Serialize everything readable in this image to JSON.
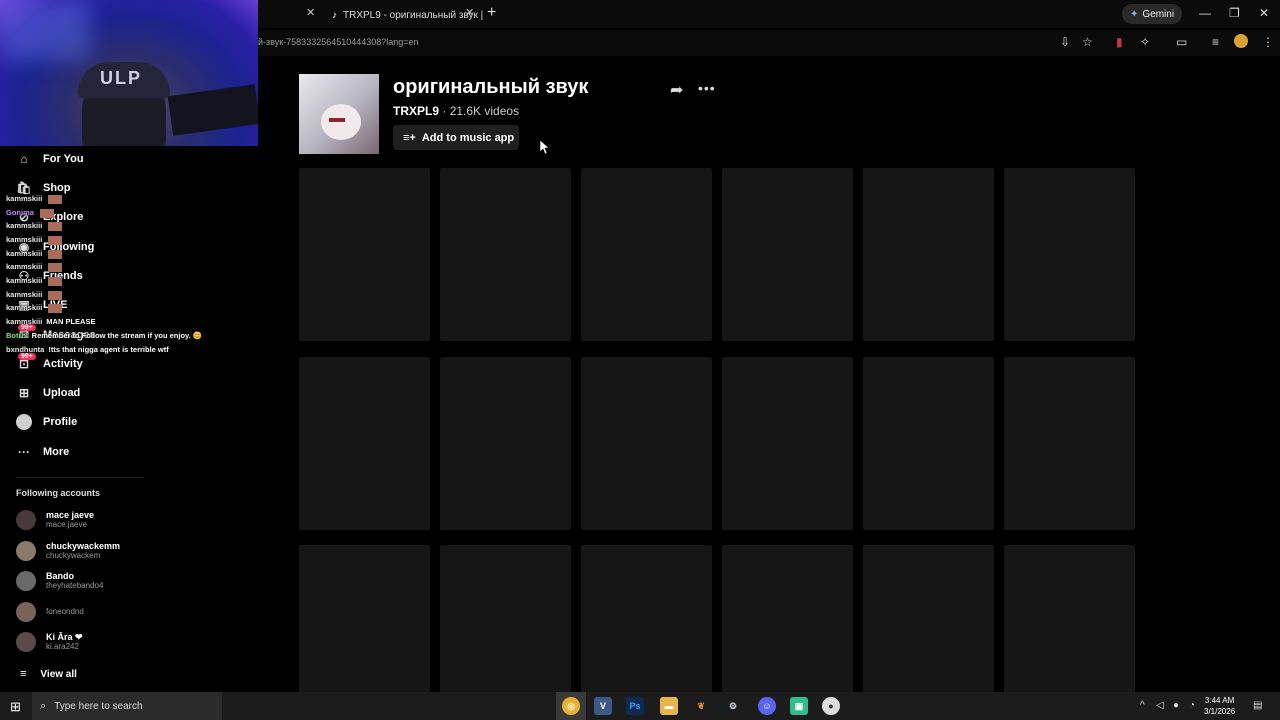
{
  "browser": {
    "tabs": [
      {
        "label": "",
        "close": "✕"
      },
      {
        "label": "TRXPL9 - оригинальный звук |",
        "close": "✕"
      }
    ],
    "new_tab": "+",
    "gemini_label": "Gemini",
    "url": "й-звук-7583332564510444308?lang=en",
    "window_controls": [
      "—",
      "❐",
      "✕"
    ]
  },
  "webcam": {
    "hat_text": "ULP"
  },
  "sidebar": {
    "nav": [
      {
        "label": "For You",
        "icon": "home-icon"
      },
      {
        "label": "Shop",
        "icon": "shop-icon"
      },
      {
        "label": "Explore",
        "icon": "explore-icon"
      },
      {
        "label": "Following",
        "icon": "following-icon"
      },
      {
        "label": "Friends",
        "icon": "friends-icon"
      },
      {
        "label": "LIVE",
        "icon": "live-icon"
      },
      {
        "label": "Messages",
        "icon": "messages-icon"
      },
      {
        "label": "Activity",
        "icon": "activity-icon"
      },
      {
        "label": "Upload",
        "icon": "upload-icon"
      },
      {
        "label": "Profile",
        "icon": "profile-icon"
      },
      {
        "label": "More",
        "icon": "more-icon"
      }
    ],
    "badges": [
      "99+",
      "99+"
    ],
    "following_title": "Following accounts",
    "accounts": [
      {
        "name": "mace jaeve",
        "handle": "mace.jaeve"
      },
      {
        "name": "chuckywackemm",
        "handle": "chuckywackem"
      },
      {
        "name": "Bando",
        "handle": "theyhatebando4"
      },
      {
        "name": "",
        "handle": "foneondnd"
      },
      {
        "name": "Ki Āra ❤",
        "handle": "ki.ara242"
      }
    ],
    "view_all": "View all"
  },
  "chat": [
    {
      "user": "kammskiii",
      "msg": ""
    },
    {
      "user": "Gonima",
      "msg": ""
    },
    {
      "user": "kammskiii",
      "msg": ""
    },
    {
      "user": "kammskiii",
      "msg": ""
    },
    {
      "user": "kammskiii",
      "msg": ""
    },
    {
      "user": "kammskiii",
      "msg": ""
    },
    {
      "user": "kammskiii",
      "msg": ""
    },
    {
      "user": "kammskiii",
      "msg": ""
    },
    {
      "user": "kammskiii",
      "msg": ""
    },
    {
      "user": "kammskiii",
      "msg": "MAN PLEASE"
    },
    {
      "user": "Botrix",
      "msg": "Remember to Follow the stream if you enjoy. 😊"
    },
    {
      "user": "bxndhunta",
      "msg": "!tts that nigga agent is terrible wtf"
    }
  ],
  "sound": {
    "title": "оригинальный звук",
    "author": "TRXPL9",
    "separator": " · ",
    "video_count": "21.6K videos",
    "add_button": "Add to music app"
  },
  "taskbar": {
    "search_placeholder": "Type here to search",
    "apps": [
      "chrome",
      "V",
      "Ps",
      "files",
      "fl",
      "steam",
      "discord",
      "app",
      "obs"
    ],
    "time": "3:44 AM",
    "date": "3/1/2026"
  },
  "colors": {
    "background": "#000000",
    "card": "#161616",
    "badge": "#fe2c55",
    "button": "#1f1f1f"
  }
}
